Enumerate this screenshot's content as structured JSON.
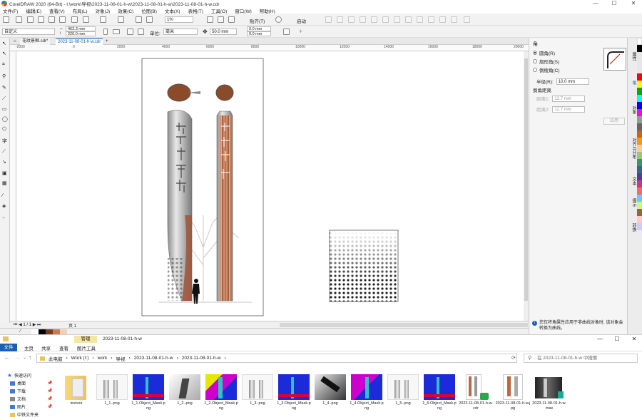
{
  "titlebar": {
    "title": "CorelDRAW 2020 (64-Bit) - I:\\work\\导视\\2023-11-08-01-h-w\\2023-11-08-01-h-w\\2023-11-08-01-h-w.cdr",
    "min": "—",
    "max": "☐",
    "close": "✕"
  },
  "menubar": [
    "文件(F)",
    "编辑(E)",
    "查看(V)",
    "布局(L)",
    "对象(J)",
    "效果(C)",
    "位图(B)",
    "文本(X)",
    "表格(T)",
    "工具(O)",
    "窗口(W)",
    "帮助(H)"
  ],
  "toolbar1": {
    "zoom": "1%",
    "snap_label": "贴齐(T)",
    "launch_label": "启动"
  },
  "toolbar2": {
    "preset": "自定义",
    "width": "463.3 mm",
    "height": "220.0 mm",
    "unit_label": "单位:",
    "unit": "毫米",
    "nudge": "50.0 mm",
    "dup_x": "0.0 mm",
    "dup_y": "0.0 mm"
  },
  "tabs": {
    "welcome": "花纹景框.cdr*",
    "doc": "2023-11-08-01-h-w.cdr",
    "add": "+"
  },
  "ruler_marks": [
    "-2000",
    "0",
    "2000",
    "4000",
    "6000",
    "8000",
    "10000",
    "12000",
    "14000",
    "16000",
    "18000",
    "20000"
  ],
  "pagebar": {
    "page": "页 1"
  },
  "docker": {
    "title": "角",
    "options": [
      {
        "label": "圆角(R)",
        "selected": true
      },
      {
        "label": "扇形角(S)",
        "selected": false
      },
      {
        "label": "倒棱角(C)",
        "selected": false
      }
    ],
    "radius_label": "半径(R):",
    "radius_value": "10.0 mm",
    "corner_dist_label": "倒角距离",
    "dist1_label": "距离1:",
    "dist1_value": "12.7 mm",
    "dist2_label": "距离2:",
    "dist2_value": "12.7 mm",
    "apply_label": "应用",
    "info": "您仅将角属性应用于非曲线对象时, 该对象会转换为曲线。"
  },
  "sidetabs": [
    "属性",
    "角",
    "对象",
    "对齐与分布",
    "文本",
    "提示",
    "转换"
  ],
  "explorer": {
    "title": "2023-11-08-01-h-w",
    "manage_tab": "管理",
    "ribbon": [
      "文件",
      "主页",
      "共享",
      "查看",
      "图片工具"
    ],
    "path": [
      "此电脑",
      "Work (I:)",
      "work",
      "导视",
      "2023-11-08-01-h-w",
      "2023-11-08-01-h-w"
    ],
    "search_placeholder": "在 2023-11-08-01-h-w 中搜索",
    "nav": [
      {
        "label": "快速访问",
        "color": "#3a7bd5"
      },
      {
        "label": "桌面",
        "color": "#3a7bd5"
      },
      {
        "label": "下载",
        "color": "#3a7bd5"
      },
      {
        "label": "文档",
        "color": "#888888"
      },
      {
        "label": "图片",
        "color": "#3a7bd5"
      },
      {
        "label": "中铁文件夹",
        "color": "#e8c45a"
      }
    ],
    "files": [
      {
        "name": "texture",
        "kind": "folder"
      },
      {
        "name": "1_1..png",
        "kind": "white"
      },
      {
        "name": "1_1.Object_Mask.png",
        "kind": "blue"
      },
      {
        "name": "1_2..png",
        "kind": "gray"
      },
      {
        "name": "1_2.Object_Mask.png",
        "kind": "multi"
      },
      {
        "name": "1_3..png",
        "kind": "white"
      },
      {
        "name": "1_3.Object_Mask.png",
        "kind": "blue"
      },
      {
        "name": "1_4..png",
        "kind": "dark"
      },
      {
        "name": "1_4.Object_Mask.png",
        "kind": "purple"
      },
      {
        "name": "1_5..png",
        "kind": "white"
      },
      {
        "name": "1_5.Object_Mask.png",
        "kind": "blue"
      },
      {
        "name": "2023-11-08-01-h-w.cdr",
        "kind": "cdr"
      },
      {
        "name": "2023-11-08-01-h-w.jpg",
        "kind": "jpg"
      },
      {
        "name": "2023-11-08-01-h-w.max",
        "kind": "max"
      }
    ]
  }
}
